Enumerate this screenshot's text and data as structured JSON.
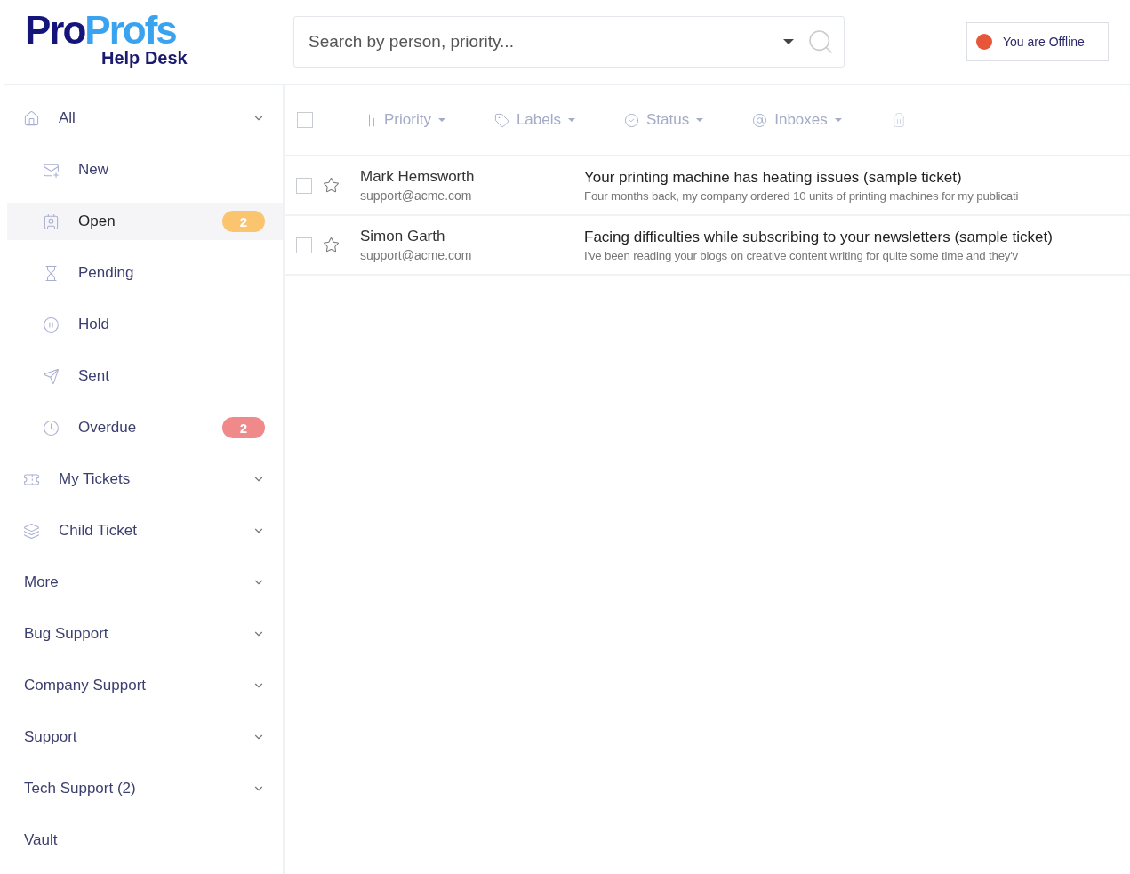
{
  "logo": {
    "part_1": "Pro",
    "part_2": "Profs",
    "subtitle": "Help Desk"
  },
  "search": {
    "placeholder": "Search by person, priority..."
  },
  "status": {
    "label": "You are Offline",
    "color": "#e8563a"
  },
  "sidebar": {
    "items": [
      {
        "label": "All",
        "expandable": true,
        "selected": false,
        "children": [
          {
            "label": "New",
            "selected": false
          },
          {
            "label": "Open",
            "selected": true,
            "badge": {
              "text": "2",
              "color": "#fbc46e"
            }
          },
          {
            "label": "Pending",
            "selected": false
          },
          {
            "label": "Hold",
            "selected": false
          },
          {
            "label": "Sent",
            "selected": false
          },
          {
            "label": "Overdue",
            "selected": false,
            "badge": {
              "text": "2",
              "color": "#f08a8a"
            }
          }
        ]
      },
      {
        "label": "My Tickets",
        "expandable": true,
        "selected": false
      },
      {
        "label": "Child Ticket",
        "expandable": true,
        "selected": false
      },
      {
        "label": "More",
        "expandable": true,
        "selected": false
      },
      {
        "label": "Bug Support",
        "expandable": true,
        "selected": false
      },
      {
        "label": "Company Support",
        "expandable": true,
        "selected": false
      },
      {
        "label": "Support",
        "expandable": true,
        "selected": false
      },
      {
        "label": "Tech Support (2)",
        "expandable": true,
        "selected": false
      },
      {
        "label": "Vault",
        "expandable": false,
        "selected": false
      }
    ]
  },
  "toolbar": {
    "select_all": {
      "checked": false
    },
    "actions": [
      {
        "label": "Priority",
        "disabled": true
      },
      {
        "label": "Labels",
        "disabled": true
      },
      {
        "label": "Status",
        "disabled": true
      },
      {
        "label": "Inboxes",
        "disabled": true
      }
    ],
    "delete": {
      "disabled": true
    }
  },
  "tickets": [
    {
      "checked": false,
      "starred": false,
      "name": "Mark Hemsworth",
      "email": "support@acme.com",
      "subject": "Your printing machine has heating issues (sample ticket)",
      "preview": "Four months back, my company ordered 10 units of printing machines for my publicati"
    },
    {
      "checked": false,
      "starred": false,
      "name": "Simon Garth",
      "email": "support@acme.com",
      "subject": "Facing difficulties while subscribing to your newsletters (sample ticket)",
      "preview": "I've been reading your blogs on creative content writing for quite some time and they'v"
    }
  ]
}
